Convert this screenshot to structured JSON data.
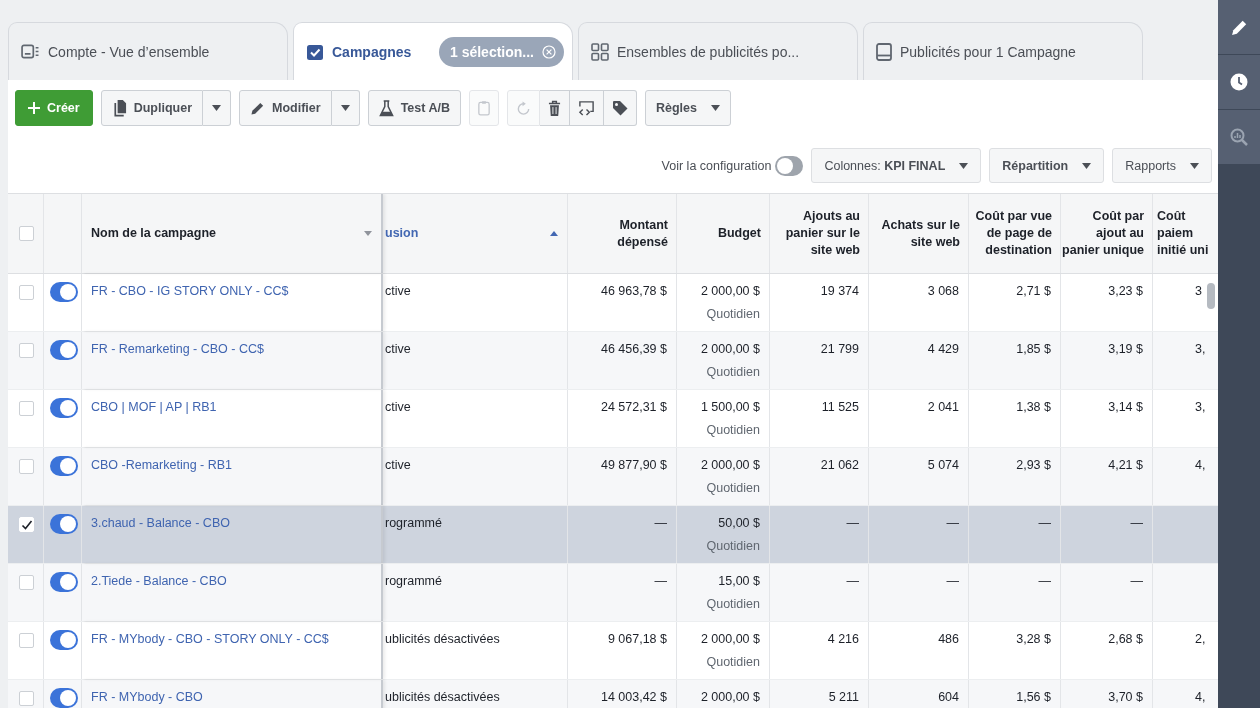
{
  "tabs": [
    {
      "kind": "account",
      "label": "Compte - Vue d’ensemble",
      "selected": false
    },
    {
      "kind": "campaigns",
      "label": "Campagnes",
      "selected": true,
      "chip": "1 sélection..."
    },
    {
      "kind": "adsets",
      "label": "Ensembles de publicités po...",
      "selected": false
    },
    {
      "kind": "ads",
      "label": "Publicités pour 1 Campagne",
      "selected": false
    }
  ],
  "toolbar": {
    "create": "Créer",
    "duplicate": "Dupliquer",
    "edit": "Modifier",
    "ab_test": "Test A/B",
    "icon_groups": [
      {
        "actions": [
          {
            "kind": "clipboard",
            "disabled": true
          }
        ]
      },
      {
        "actions": [
          {
            "kind": "refresh",
            "disabled": true
          },
          {
            "kind": "trash",
            "disabled": false
          },
          {
            "kind": "swap",
            "disabled": false
          },
          {
            "kind": "tag",
            "disabled": false
          }
        ]
      }
    ],
    "rules": "Règles"
  },
  "view_bar": {
    "config_label": "Voir la configuration",
    "config_on": false,
    "columns_button": "Colonnes: **KPI FINAL**",
    "breakdown_button": "Répartition",
    "reports_button": "Rapports"
  },
  "table": {
    "select_all_checked": false,
    "columns": [
      {
        "label": "Nom de la campagne",
        "ascending": false,
        "sorted": false
      },
      {
        "label": "usion",
        "ascending": true,
        "sorted": true
      },
      {
        "label": "Montant\ndépensé",
        "sorted": false
      },
      {
        "label": "Budget",
        "sorted": false
      },
      {
        "label": "Ajouts au\npanier sur le\nsite web",
        "sorted": false
      },
      {
        "label": "Achats sur le\nsite web",
        "sorted": false
      },
      {
        "label": "Coût par vue\nde page de\ndestination",
        "sorted": false
      },
      {
        "label": "Coût par\najout au\npanier unique",
        "sorted": false
      },
      {
        "label": "Coût\npaiem\ninitié uni",
        "sorted": false
      }
    ],
    "rows": [
      {
        "selected": false,
        "on": true,
        "name": "FR - CBO - IG STORY ONLY - CC$",
        "status": "ctive",
        "spent": "46 963,78 $",
        "budget": "2 000,00 $",
        "budget_period": "Quotidien",
        "cart_adds": "19 374",
        "purchases": "3 068",
        "cost_landing_view": "2,71 $",
        "cost_cart_add": "3,23 $",
        "cost_checkout": "3"
      },
      {
        "selected": false,
        "on": true,
        "name": "FR - Remarketing - CBO - CC$",
        "status": "ctive",
        "spent": "46 456,39 $",
        "budget": "2 000,00 $",
        "budget_period": "Quotidien",
        "cart_adds": "21 799",
        "purchases": "4 429",
        "cost_landing_view": "1,85 $",
        "cost_cart_add": "3,19 $",
        "cost_checkout": "3,"
      },
      {
        "selected": false,
        "on": true,
        "name": "CBO | MOF | AP | RB1",
        "status": "ctive",
        "spent": "24 572,31 $",
        "budget": "1 500,00 $",
        "budget_period": "Quotidien",
        "cart_adds": "11 525",
        "purchases": "2 041",
        "cost_landing_view": "1,38 $",
        "cost_cart_add": "3,14 $",
        "cost_checkout": "3,"
      },
      {
        "selected": false,
        "on": true,
        "name": "CBO -Remarketing - RB1",
        "status": "ctive",
        "spent": "49 877,90 $",
        "budget": "2 000,00 $",
        "budget_period": "Quotidien",
        "cart_adds": "21 062",
        "purchases": "5 074",
        "cost_landing_view": "2,93 $",
        "cost_cart_add": "4,21 $",
        "cost_checkout": "4,"
      },
      {
        "selected": true,
        "on": true,
        "name": "3.chaud - Balance - CBO",
        "status": "rogrammé",
        "spent": "—",
        "budget": "50,00 $",
        "budget_period": "Quotidien",
        "cart_adds": "—",
        "purchases": "—",
        "cost_landing_view": "—",
        "cost_cart_add": "—"
      },
      {
        "selected": false,
        "on": true,
        "name": "2.Tiede - Balance - CBO",
        "status": "rogrammé",
        "spent": "—",
        "budget": "15,00 $",
        "budget_period": "Quotidien",
        "cart_adds": "—",
        "purchases": "—",
        "cost_landing_view": "—",
        "cost_cart_add": "—"
      },
      {
        "selected": false,
        "on": true,
        "name": "FR - MYbody - CBO - STORY ONLY - CC$",
        "status": "ublicités désactivées",
        "spent": "9 067,18 $",
        "budget": "2 000,00 $",
        "budget_period": "Quotidien",
        "cart_adds": "4 216",
        "purchases": "486",
        "cost_landing_view": "3,28 $",
        "cost_cart_add": "2,68 $",
        "cost_checkout": "2,"
      },
      {
        "selected": false,
        "on": true,
        "name": "FR - MYbody - CBO",
        "status": "ublicités désactivées",
        "spent": "14 003,42 $",
        "budget": "2 000,00 $",
        "cart_adds": "5 211",
        "purchases": "604",
        "cost_landing_view": "1,56 $",
        "cost_cart_add": "3,70 $",
        "cost_checkout": "4,"
      }
    ]
  }
}
